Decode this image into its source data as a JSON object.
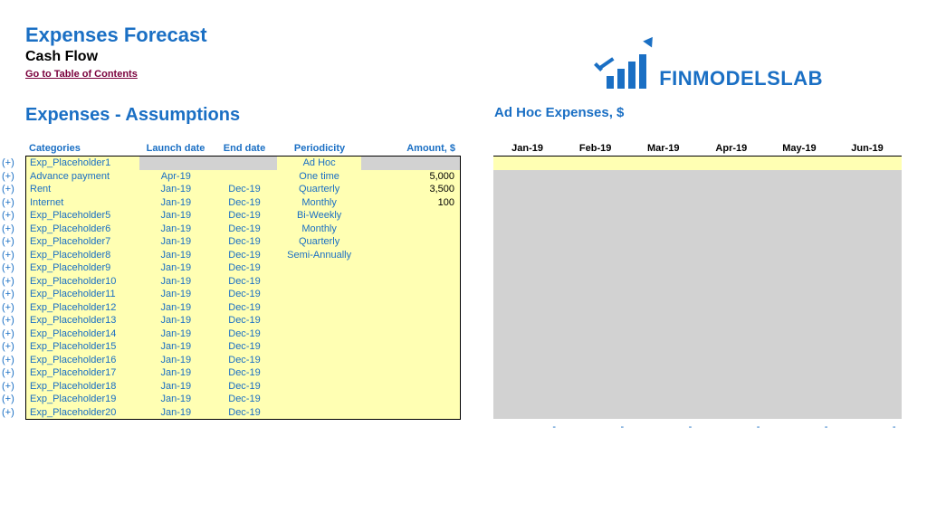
{
  "header": {
    "title": "Expenses Forecast",
    "subtitle": "Cash Flow",
    "toc_link": "Go to Table of Contents"
  },
  "logo_text": "FINMODELSLAB",
  "sections": {
    "left": "Expenses - Assumptions",
    "right": "Ad Hoc Expenses, $"
  },
  "left_table": {
    "headers": {
      "categories": "Categories",
      "launch": "Launch date",
      "end": "End date",
      "periodicity": "Periodicity",
      "amount": "Amount, $"
    },
    "rows": [
      {
        "cat": "Exp_Placeholder1",
        "launch": "",
        "end": "",
        "period": "Ad Hoc",
        "amount": ""
      },
      {
        "cat": "Advance payment",
        "launch": "Apr-19",
        "end": "",
        "period": "One time",
        "amount": "5,000"
      },
      {
        "cat": "Rent",
        "launch": "Jan-19",
        "end": "Dec-19",
        "period": "Quarterly",
        "amount": "3,500"
      },
      {
        "cat": "Internet",
        "launch": "Jan-19",
        "end": "Dec-19",
        "period": "Monthly",
        "amount": "100"
      },
      {
        "cat": "Exp_Placeholder5",
        "launch": "Jan-19",
        "end": "Dec-19",
        "period": "Bi-Weekly",
        "amount": ""
      },
      {
        "cat": "Exp_Placeholder6",
        "launch": "Jan-19",
        "end": "Dec-19",
        "period": "Monthly",
        "amount": ""
      },
      {
        "cat": "Exp_Placeholder7",
        "launch": "Jan-19",
        "end": "Dec-19",
        "period": "Quarterly",
        "amount": ""
      },
      {
        "cat": "Exp_Placeholder8",
        "launch": "Jan-19",
        "end": "Dec-19",
        "period": "Semi-Annually",
        "amount": ""
      },
      {
        "cat": "Exp_Placeholder9",
        "launch": "Jan-19",
        "end": "Dec-19",
        "period": "",
        "amount": ""
      },
      {
        "cat": "Exp_Placeholder10",
        "launch": "Jan-19",
        "end": "Dec-19",
        "period": "",
        "amount": ""
      },
      {
        "cat": "Exp_Placeholder11",
        "launch": "Jan-19",
        "end": "Dec-19",
        "period": "",
        "amount": ""
      },
      {
        "cat": "Exp_Placeholder12",
        "launch": "Jan-19",
        "end": "Dec-19",
        "period": "",
        "amount": ""
      },
      {
        "cat": "Exp_Placeholder13",
        "launch": "Jan-19",
        "end": "Dec-19",
        "period": "",
        "amount": ""
      },
      {
        "cat": "Exp_Placeholder14",
        "launch": "Jan-19",
        "end": "Dec-19",
        "period": "",
        "amount": ""
      },
      {
        "cat": "Exp_Placeholder15",
        "launch": "Jan-19",
        "end": "Dec-19",
        "period": "",
        "amount": ""
      },
      {
        "cat": "Exp_Placeholder16",
        "launch": "Jan-19",
        "end": "Dec-19",
        "period": "",
        "amount": ""
      },
      {
        "cat": "Exp_Placeholder17",
        "launch": "Jan-19",
        "end": "Dec-19",
        "period": "",
        "amount": ""
      },
      {
        "cat": "Exp_Placeholder18",
        "launch": "Jan-19",
        "end": "Dec-19",
        "period": "",
        "amount": ""
      },
      {
        "cat": "Exp_Placeholder19",
        "launch": "Jan-19",
        "end": "Dec-19",
        "period": "",
        "amount": ""
      },
      {
        "cat": "Exp_Placeholder20",
        "launch": "Jan-19",
        "end": "Dec-19",
        "period": "",
        "amount": ""
      }
    ]
  },
  "right_table": {
    "months": [
      "Jan-19",
      "Feb-19",
      "Mar-19",
      "Apr-19",
      "May-19",
      "Jun-19"
    ],
    "footer_dash": "-"
  },
  "plus_label": "(+)"
}
